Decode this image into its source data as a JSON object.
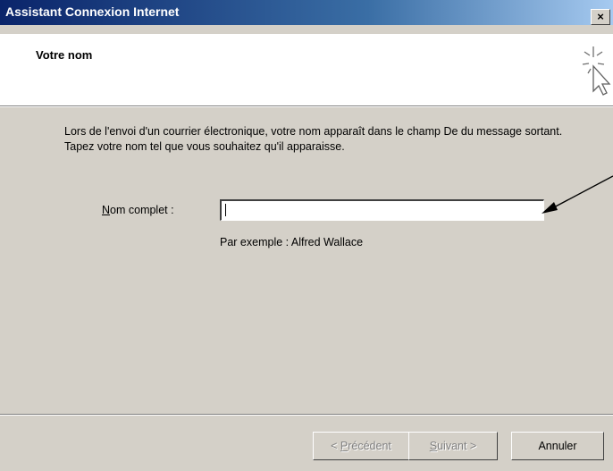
{
  "window": {
    "title": "Assistant Connexion Internet",
    "close_glyph": "×"
  },
  "header": {
    "title": "Votre nom",
    "icon": "wizard-sparkle-cursor-icon"
  },
  "main": {
    "description": "Lors de l'envoi d'un courrier électronique, votre nom apparaît dans le champ De du message sortant. Tapez votre nom tel que vous souhaitez qu'il apparaisse.",
    "field": {
      "label_mnemonic": "N",
      "label_rest": "om complet :",
      "value": "",
      "example": "Par exemple : Alfred Wallace"
    }
  },
  "footer": {
    "prev_mnemonic": "P",
    "prev_prefix": "< ",
    "prev_rest": "récédent",
    "next_mnemonic": "S",
    "next_rest": "uivant >",
    "cancel_label": "Annuler"
  },
  "colors": {
    "titlebar_start": "#0a246a",
    "titlebar_end": "#a6caf0",
    "dialog_face": "#d4d0c8",
    "header_bg": "#ffffff",
    "disabled_text": "#808080"
  }
}
